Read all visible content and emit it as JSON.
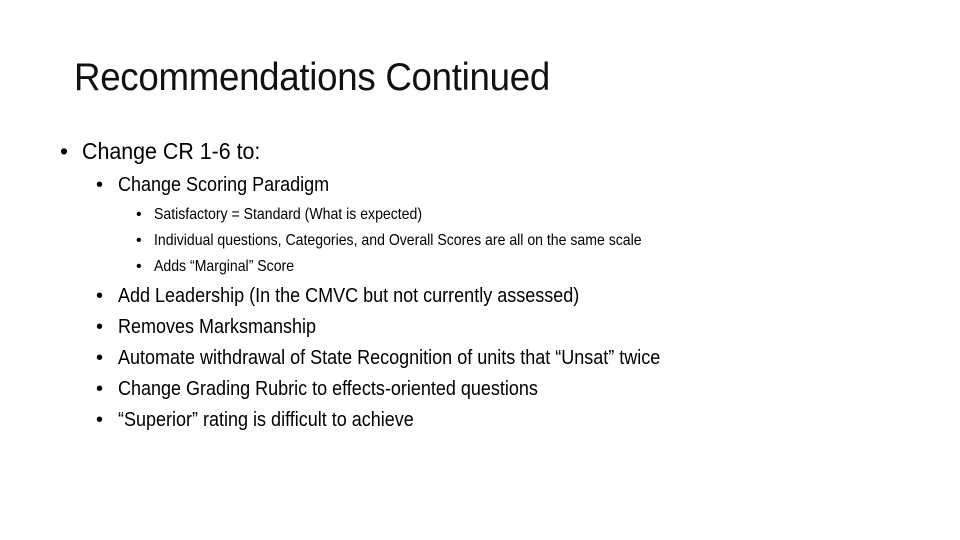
{
  "slide": {
    "title": "Recommendations Continued",
    "bullet_glyph": "•",
    "level1": [
      {
        "text": "Change CR 1-6 to:"
      }
    ],
    "scoring": {
      "text": "Change Scoring Paradigm",
      "subitems": [
        "Satisfactory = Standard  (What is expected)",
        "Individual questions, Categories, and Overall Scores are all on the same scale",
        "Adds “Marginal” Score"
      ]
    },
    "level2_items": [
      "Add Leadership (In the CMVC but not currently assessed)",
      "Removes Marksmanship",
      "Automate withdrawal of State Recognition of units that “Unsat” twice",
      "Change Grading Rubric to effects-oriented questions",
      "“Superior” rating is difficult to achieve"
    ]
  }
}
